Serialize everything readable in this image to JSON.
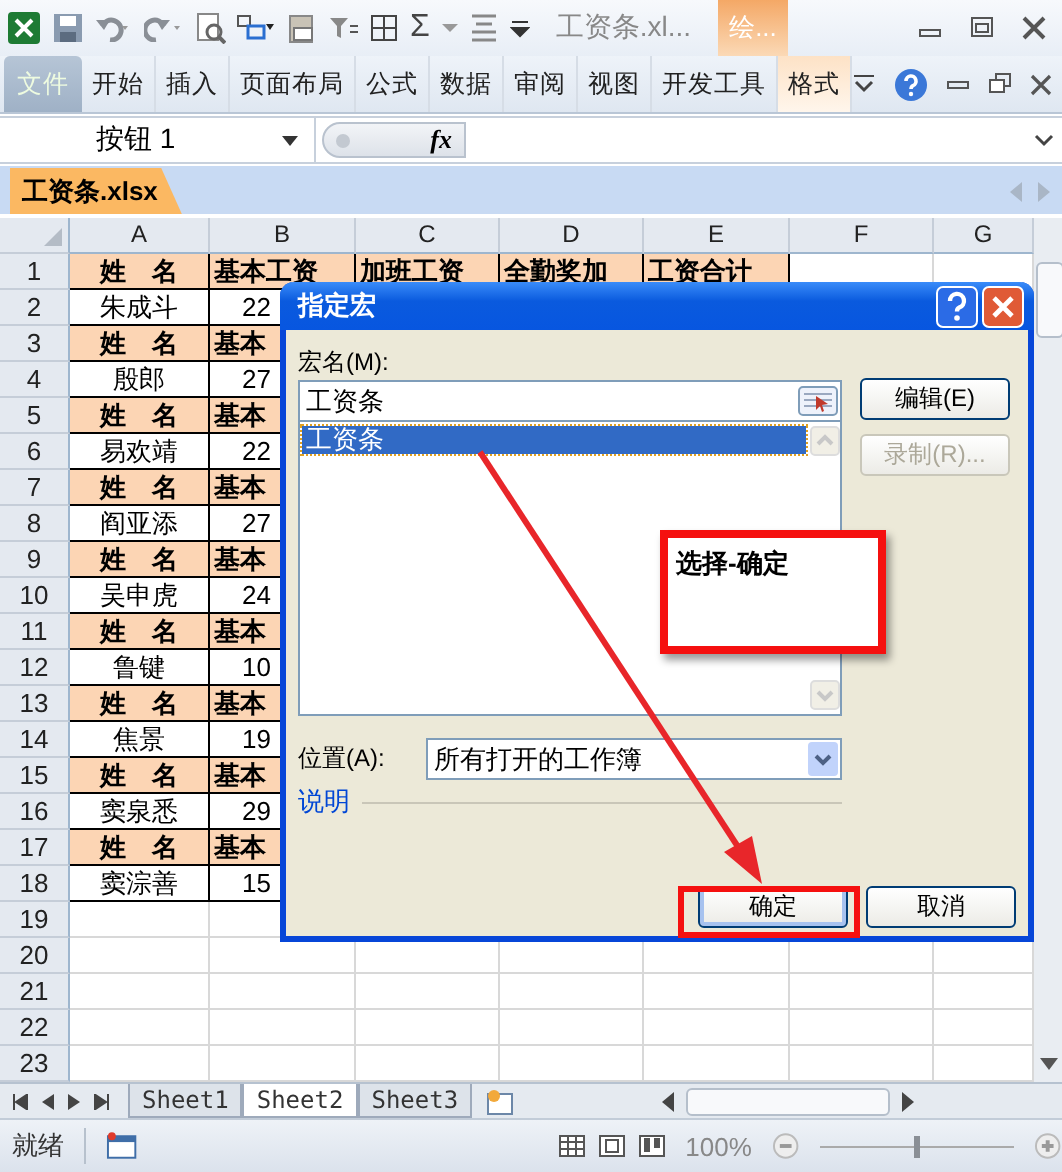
{
  "app": {
    "title": "工资条.xl...",
    "context_group": "绘...",
    "sum_symbol": "Σ"
  },
  "ribbon": {
    "tabs": [
      {
        "label": "文件",
        "kind": "file"
      },
      {
        "label": "开始",
        "kind": "normal"
      },
      {
        "label": "插入",
        "kind": "normal"
      },
      {
        "label": "页面布局",
        "kind": "normal"
      },
      {
        "label": "公式",
        "kind": "normal"
      },
      {
        "label": "数据",
        "kind": "normal"
      },
      {
        "label": "审阅",
        "kind": "normal"
      },
      {
        "label": "视图",
        "kind": "normal"
      },
      {
        "label": "开发工具",
        "kind": "normal"
      },
      {
        "label": "格式",
        "kind": "context"
      }
    ]
  },
  "name_box": {
    "value": "按钮 1"
  },
  "formula_bar": {
    "fx": "fx"
  },
  "workbook_tab": "工资条.xlsx",
  "columns": [
    "A",
    "B",
    "C",
    "D",
    "E",
    "F",
    "G"
  ],
  "rows": [
    {
      "number": "1",
      "kind": "header",
      "cells": [
        "姓　名",
        "基本工资",
        "加班工资",
        "全勤奖加",
        "工资合计"
      ]
    },
    {
      "number": "2",
      "kind": "data",
      "cells": [
        "朱成斗",
        "22"
      ]
    },
    {
      "number": "3",
      "kind": "header",
      "cells": [
        "姓　名",
        "基本"
      ]
    },
    {
      "number": "4",
      "kind": "data",
      "cells": [
        "殷郎",
        "27"
      ]
    },
    {
      "number": "5",
      "kind": "header",
      "cells": [
        "姓　名",
        "基本"
      ]
    },
    {
      "number": "6",
      "kind": "data",
      "cells": [
        "易欢靖",
        "22"
      ]
    },
    {
      "number": "7",
      "kind": "header",
      "cells": [
        "姓　名",
        "基本"
      ]
    },
    {
      "number": "8",
      "kind": "data",
      "cells": [
        "阎亚添",
        "27"
      ]
    },
    {
      "number": "9",
      "kind": "header",
      "cells": [
        "姓　名",
        "基本"
      ]
    },
    {
      "number": "10",
      "kind": "data",
      "cells": [
        "吴申虎",
        "24"
      ]
    },
    {
      "number": "11",
      "kind": "header",
      "cells": [
        "姓　名",
        "基本"
      ]
    },
    {
      "number": "12",
      "kind": "data",
      "cells": [
        "鲁键",
        "10"
      ]
    },
    {
      "number": "13",
      "kind": "header",
      "cells": [
        "姓　名",
        "基本"
      ]
    },
    {
      "number": "14",
      "kind": "data",
      "cells": [
        "焦景",
        "19"
      ]
    },
    {
      "number": "15",
      "kind": "header",
      "cells": [
        "姓　名",
        "基本"
      ]
    },
    {
      "number": "16",
      "kind": "data",
      "cells": [
        "窦泉悉",
        "29"
      ]
    },
    {
      "number": "17",
      "kind": "header",
      "cells": [
        "姓　名",
        "基本"
      ]
    },
    {
      "number": "18",
      "kind": "data",
      "cells": [
        "窦淙善",
        "15"
      ]
    },
    {
      "number": "19",
      "kind": "empty"
    },
    {
      "number": "20",
      "kind": "empty"
    },
    {
      "number": "21",
      "kind": "empty"
    },
    {
      "number": "22",
      "kind": "empty"
    },
    {
      "number": "23",
      "kind": "empty"
    }
  ],
  "dialog": {
    "title": "指定宏",
    "macro_name_label": "宏名(M):",
    "macro_name_value": "工资条",
    "macros": [
      {
        "name": "工资条",
        "selected": true
      }
    ],
    "side_buttons": [
      {
        "label": "编辑(E)",
        "disabled": false
      },
      {
        "label": "录制(R)...",
        "disabled": true
      }
    ],
    "location_label": "位置(A):",
    "location_value": "所有打开的工作簿",
    "description_label": "说明",
    "ok": "确定",
    "cancel": "取消"
  },
  "annotation": {
    "text": "选择-确定"
  },
  "sheets": [
    {
      "label": "Sheet1",
      "selected": false
    },
    {
      "label": "Sheet2",
      "selected": true
    },
    {
      "label": "Sheet3",
      "selected": false
    }
  ],
  "status": {
    "text": "就绪",
    "zoom": {
      "reading": "100%",
      "level": 0.5
    }
  }
}
